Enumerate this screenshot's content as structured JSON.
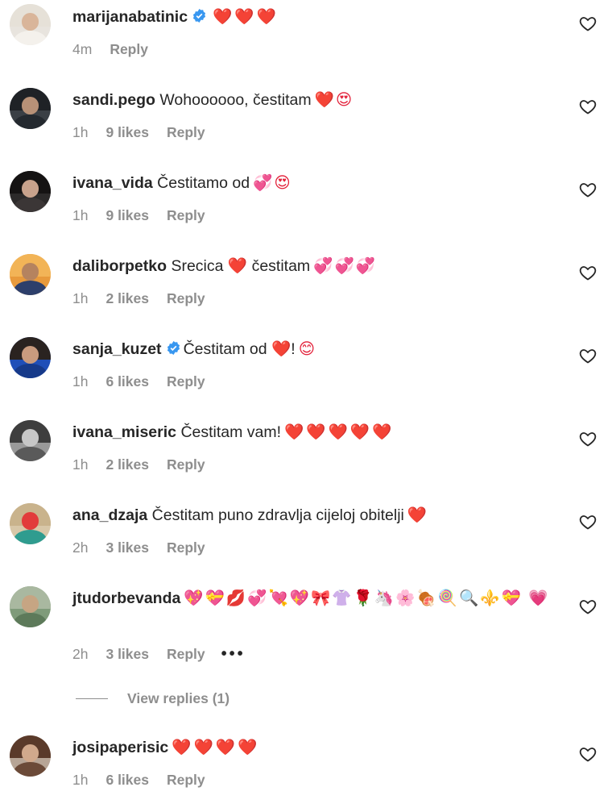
{
  "comments": [
    {
      "username": "marijanabatinic",
      "verified": true,
      "text": "",
      "emojis": "❤️❤️❤️",
      "time": "4m",
      "likes": "",
      "reply": "Reply"
    },
    {
      "username": "sandi.pego",
      "verified": false,
      "text": "Wohoooooo, čestitam",
      "emojis": "❤️😍",
      "time": "1h",
      "likes": "9 likes",
      "reply": "Reply"
    },
    {
      "username": "ivana_vida",
      "verified": false,
      "text": "Čestitamo od",
      "emojis": "💞😍",
      "time": "1h",
      "likes": "9 likes",
      "reply": "Reply"
    },
    {
      "username": "daliborpetko",
      "verified": false,
      "text": "Srecica ❤️ čestitam",
      "emojis": "💞💞💞",
      "time": "1h",
      "likes": "2 likes",
      "reply": "Reply"
    },
    {
      "username": "sanja_kuzet",
      "verified": true,
      "text": "Čestitam od ❤️!",
      "emojis": "😊",
      "time": "1h",
      "likes": "6 likes",
      "reply": "Reply"
    },
    {
      "username": "ivana_miseric",
      "verified": false,
      "text": "Čestitam vam!",
      "emojis": "❤️❤️❤️❤️❤️",
      "time": "1h",
      "likes": "2 likes",
      "reply": "Reply"
    },
    {
      "username": "ana_dzaja",
      "verified": false,
      "text": "Čestitam puno zdravlja cijeloj obitelji",
      "emojis": "❤️",
      "time": "2h",
      "likes": "3 likes",
      "reply": "Reply"
    },
    {
      "username": "jtudorbevanda",
      "verified": false,
      "text": "",
      "emojis": "💖💝💋💞💘💖🎀👚🌹🦄🌸🍖🍭🔍⚜️💝 💗",
      "time": "2h",
      "likes": "3 likes",
      "reply": "Reply",
      "more": "•••"
    },
    {
      "username": "josipaperisic",
      "verified": false,
      "text": "",
      "emojis": "❤️❤️❤️❤️",
      "time": "1h",
      "likes": "6 likes",
      "reply": "Reply"
    }
  ],
  "view_replies": "View replies (1)",
  "icons": {
    "like": "heart-outline-icon",
    "verified": "verified-badge-icon",
    "more": "more-options-icon"
  },
  "colors": {
    "verified": "#3897f0",
    "meta": "#8e8e8e",
    "heart": "#e3213a"
  }
}
